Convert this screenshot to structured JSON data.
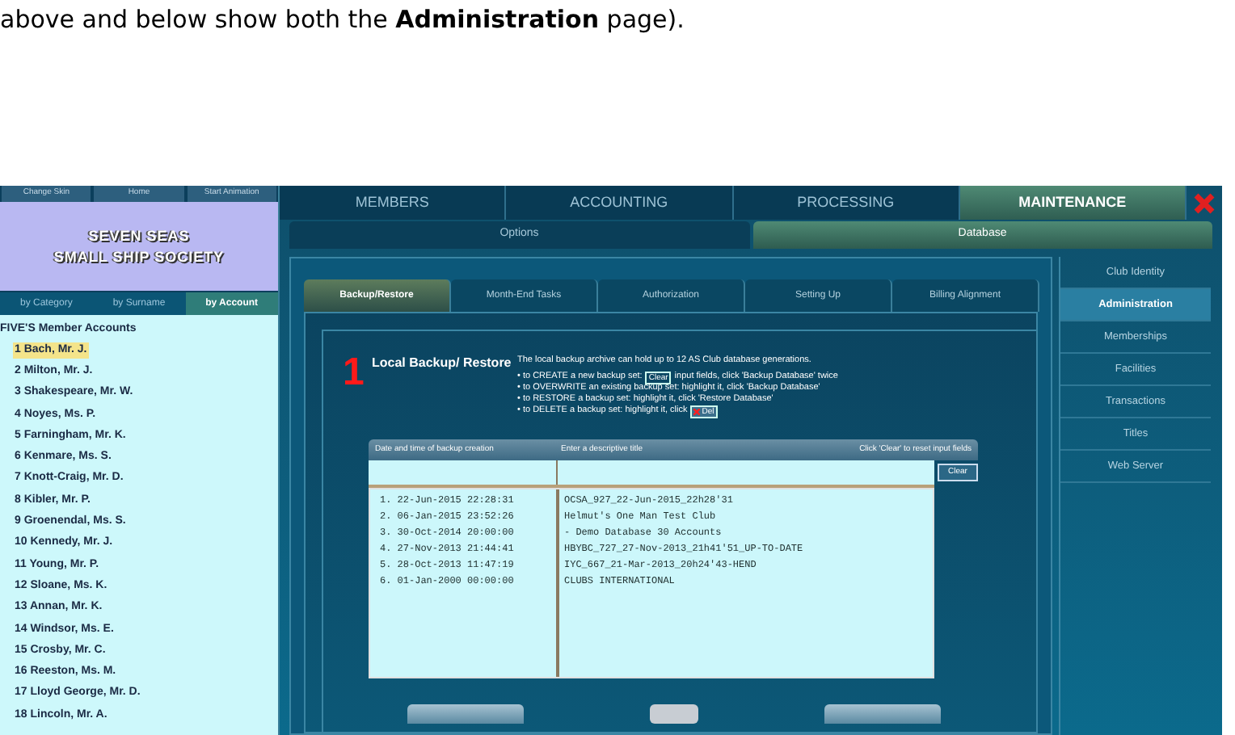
{
  "intro_text": "above and below show both the **Administration** page).",
  "left_panel": {
    "top_buttons": [
      "Change Skin",
      "Home",
      "Start Animation"
    ],
    "logo_lines": [
      "SEVEN SEAS",
      "SMALL SHIP SOCIETY"
    ],
    "tabs": [
      {
        "label": "by Category",
        "selected": false
      },
      {
        "label": "by Surname",
        "selected": false
      },
      {
        "label": "by Account",
        "selected": true
      }
    ],
    "list_title": "FIVE'S Member Accounts",
    "members": [
      {
        "label": "1 Bach, Mr. J.",
        "selected": true
      },
      {
        "label": "2 Milton, Mr. J.",
        "selected": false
      },
      {
        "label": "3 Shakespeare, Mr. W.",
        "selected": false
      },
      {
        "label": "4 Noyes, Ms. P.",
        "selected": false
      },
      {
        "label": "5 Farningham, Mr. K.",
        "selected": false
      },
      {
        "label": "6 Kenmare, Ms. S.",
        "selected": false
      },
      {
        "label": "7 Knott-Craig, Mr. D.",
        "selected": false
      },
      {
        "label": "8 Kibler, Mr. P.",
        "selected": false
      },
      {
        "label": "9 Groenendal, Ms. S.",
        "selected": false
      },
      {
        "label": "10 Kennedy, Mr. J.",
        "selected": false
      },
      {
        "label": "11 Young, Mr. P.",
        "selected": false
      },
      {
        "label": "12 Sloane, Ms. K.",
        "selected": false
      },
      {
        "label": "13 Annan, Mr. K.",
        "selected": false
      },
      {
        "label": "14 Windsor, Ms. E.",
        "selected": false
      },
      {
        "label": "15 Crosby, Mr. C.",
        "selected": false
      },
      {
        "label": "16 Reeston, Ms. M.",
        "selected": false
      },
      {
        "label": "17 Lloyd George, Mr. D.",
        "selected": false
      },
      {
        "label": "18 Lincoln, Mr. A.",
        "selected": false
      }
    ]
  },
  "main_tabs": [
    {
      "label": "MEMBERS",
      "selected": false
    },
    {
      "label": "ACCOUNTING",
      "selected": false
    },
    {
      "label": "PROCESSING",
      "selected": false
    },
    {
      "label": "MAINTENANCE",
      "selected": true
    }
  ],
  "sub_tabs": [
    {
      "label": "Options",
      "selected": false
    },
    {
      "label": "Database",
      "selected": true
    }
  ],
  "section_tabs": [
    {
      "label": "Backup/Restore",
      "selected": true
    },
    {
      "label": "Month-End Tasks",
      "selected": false
    },
    {
      "label": "Authorization",
      "selected": false
    },
    {
      "label": "Setting Up",
      "selected": false
    },
    {
      "label": "Billing Alignment",
      "selected": false
    }
  ],
  "side_menu": [
    {
      "label": "Club Identity",
      "selected": false
    },
    {
      "label": "Administration",
      "selected": true
    },
    {
      "label": "Memberships",
      "selected": false
    },
    {
      "label": "Facilities",
      "selected": false
    },
    {
      "label": "Transactions",
      "selected": false
    },
    {
      "label": "Titles",
      "selected": false
    },
    {
      "label": "Web Server",
      "selected": false
    }
  ],
  "section": {
    "number": "1",
    "title": "Local Backup/ Restore",
    "intro": "The local backup archive can hold up to 12 AS Club database generations.",
    "instructions": [
      {
        "parts": [
          {
            "kind": "text",
            "text": "• to CREATE a new backup set:"
          },
          {
            "kind": "button",
            "text": "Clear"
          },
          {
            "kind": "text",
            "text": "input fields, click 'Backup Database' twice"
          }
        ]
      },
      {
        "parts": [
          {
            "kind": "text",
            "text": "• to OVERWRITE an existing backup set: highlight it, click 'Backup Database'"
          }
        ]
      },
      {
        "parts": [
          {
            "kind": "text",
            "text": "• to RESTORE a backup set: highlight it, click 'Restore Database'"
          }
        ]
      },
      {
        "parts": [
          {
            "kind": "text",
            "text": "• to DELETE a backup set: highlight it, click"
          },
          {
            "kind": "delete_button",
            "text": "Del"
          }
        ]
      }
    ]
  },
  "backup_table": {
    "columns": [
      "Date and time of backup creation",
      "Enter a descriptive title"
    ],
    "hint": "Click 'Clear' to reset input fields",
    "clear_button": "Clear",
    "rows": [
      {
        "date": "1. 22-Jun-2015 22:28:31",
        "title": "OCSA_927_22-Jun-2015_22h28'31"
      },
      {
        "date": "2. 06-Jan-2015 23:52:26",
        "title": "Helmut's One Man Test Club"
      },
      {
        "date": "3. 30-Oct-2014 20:00:00",
        "title": "- Demo Database 30 Accounts"
      },
      {
        "date": "4. 27-Nov-2013 21:44:41",
        "title": "HBYBC_727_27-Nov-2013_21h41'51_UP-TO-DATE"
      },
      {
        "date": "5. 28-Oct-2013 11:47:19",
        "title": "IYC_667_21-Mar-2013_20h24'43-HEND"
      },
      {
        "date": "6. 01-Jan-2000 00:00:00",
        "title": "CLUBS INTERNATIONAL"
      }
    ]
  }
}
